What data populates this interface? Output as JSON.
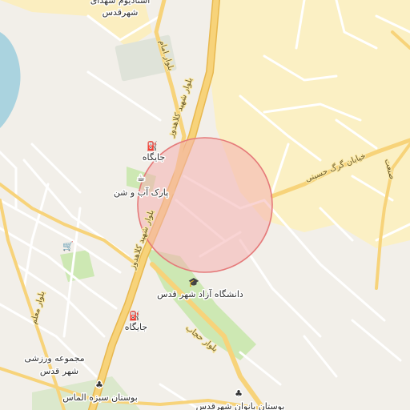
{
  "labels": {
    "stadium": "استادیوم شهدای شهرقدس",
    "gas_station_1": "جایگاه",
    "park_ab": "پارک آب و شن",
    "azad_univ": "دانشگاه آزاد شهر قدس",
    "gas_station_2": "جایگاه",
    "sports_complex": "مجموعه ورزشی شهر قدس",
    "boostan_almas": "بوستان سبزه الماس",
    "boostan_banovan": "بوستان بانوان شهرقدس"
  },
  "roads": {
    "blvd_shahid_kalahdouz": "بلوار شهید کلاهدوز",
    "blvd_emam": "بلوار امام",
    "blvd_hejab": "بلوار حجاب",
    "blvd_moallem": "بلوار معلم",
    "kh_gorg_hosseini": "خیابان گرگ حسینی",
    "sanat": "صنعت"
  },
  "icons": [
    "fuel-icon",
    "cafe-icon",
    "university-icon",
    "tree-icon",
    "shopping-cart-icon"
  ],
  "colors": {
    "background": "#f2efe9",
    "residential": "#fbf0c4",
    "park": "#cde8b3",
    "water": "#aad3df",
    "major_road": "#f7d37a",
    "minor_road": "#ffffff",
    "circle_fill": "#f4b0b0",
    "circle_stroke": "#e57a7a"
  },
  "overlay": {
    "type": "circle"
  }
}
